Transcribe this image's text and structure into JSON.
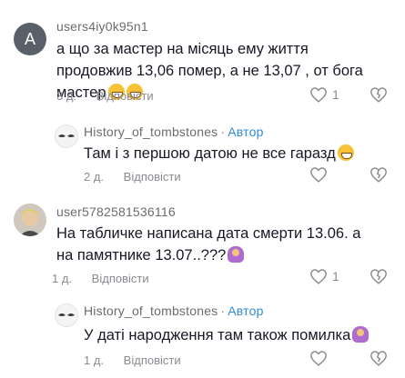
{
  "comments": [
    {
      "username": "users4iy0k95n1",
      "avatar_letter": "A",
      "text": "а що за мастер на місяць ему життя продовжив 13,06 помер, а не 13,07 , от бога мастер",
      "emoji": [
        "grin",
        "grin"
      ],
      "time": "3 д.",
      "reply_label": "Відповісти",
      "like_count": "1"
    },
    {
      "username": "History_of_tombstones",
      "author_label": "Автор",
      "text": "Там і з першою датою не все гаразд",
      "emoji": [
        "grin"
      ],
      "time": "2 д.",
      "reply_label": "Відповісти",
      "like_count": ""
    },
    {
      "username": "user5782581536116",
      "text": "На табличке написана дата смерти 13.06. а на памятнике 13.07..???",
      "emoji": [
        "facepalm"
      ],
      "time": "1 д.",
      "reply_label": "Відповісти",
      "like_count": "1"
    },
    {
      "username": "History_of_tombstones",
      "author_label": "Автор",
      "text": "У даті народження там також помилка",
      "emoji": [
        "facepalm"
      ],
      "time": "1 д.",
      "reply_label": "Відповісти",
      "like_count": ""
    }
  ],
  "icons": {
    "like": "heart-outline-icon",
    "dislike": "broken-heart-outline-icon"
  },
  "colors": {
    "author_tag": "#2f8bd6",
    "meta_text": "#8a8b91"
  }
}
